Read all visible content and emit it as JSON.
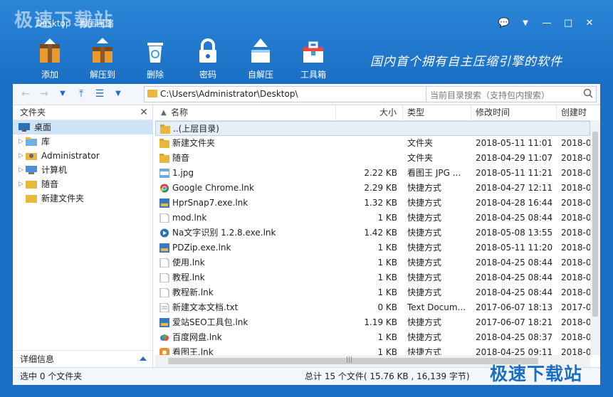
{
  "watermark": "极速下载站",
  "window": {
    "title": "Desktop - 看图压缩"
  },
  "window_controls": {
    "feedback": "💬",
    "menu": "▼",
    "minimize": "—",
    "maximize": "□",
    "close": "✕"
  },
  "toolbar": [
    {
      "label": "添加"
    },
    {
      "label": "解压到"
    },
    {
      "label": "删除"
    },
    {
      "label": "密码"
    },
    {
      "label": "自解压"
    },
    {
      "label": "工具箱"
    }
  ],
  "slogan": "国内首个拥有自主压缩引擎的软件",
  "nav": {
    "back": "←",
    "forward": "→",
    "dropdown": "▼",
    "up": "⤒",
    "view": "☰",
    "view_dd": "▼",
    "address": "C:\\Users\\Administrator\\Desktop\\",
    "search_placeholder": "当前目录搜索（支持包内搜索）"
  },
  "left_pane": {
    "title": "文件夹",
    "close": "✕",
    "items": [
      {
        "label": "桌面",
        "selected": true,
        "icon": "desktop-icon"
      },
      {
        "label": "库",
        "icon": "library-icon"
      },
      {
        "label": "Administrator",
        "icon": "user-folder-icon"
      },
      {
        "label": "计算机",
        "icon": "computer-icon"
      },
      {
        "label": "随音",
        "icon": "folder-icon"
      },
      {
        "label": "新建文件夹",
        "icon": "folder-icon"
      }
    ],
    "footer": "详细信息"
  },
  "columns": {
    "name": "名称",
    "size": "大小",
    "type": "类型",
    "modified": "修改时间",
    "created": "创建时"
  },
  "files": [
    {
      "name": "..(上层目录)",
      "size": "",
      "type": "",
      "modified": "",
      "created": "",
      "icon": "folder-icon"
    },
    {
      "name": "新建文件夹",
      "size": "",
      "type": "文件夹",
      "modified": "2018-05-11 11:01",
      "created": "2018-0",
      "icon": "folder-icon"
    },
    {
      "name": "随音",
      "size": "",
      "type": "文件夹",
      "modified": "2018-04-29 11:07",
      "created": "2018-0",
      "icon": "folder-icon"
    },
    {
      "name": "1.jpg",
      "size": "2.22 KB",
      "type": "看图王 JPG ...",
      "modified": "2018-05-11 11:21",
      "created": "2018-0",
      "icon": "jpg-icon"
    },
    {
      "name": "Google Chrome.lnk",
      "size": "2.29 KB",
      "type": "快捷方式",
      "modified": "2018-04-27 12:11",
      "created": "2018-0",
      "icon": "chrome-icon"
    },
    {
      "name": "HprSnap7.exe.lnk",
      "size": "1.32 KB",
      "type": "快捷方式",
      "modified": "2018-04-28 16:44",
      "created": "2018-0",
      "icon": "app-icon"
    },
    {
      "name": "mod.lnk",
      "size": "1 KB",
      "type": "快捷方式",
      "modified": "2018-04-25 08:44",
      "created": "2018-0",
      "icon": "file-icon"
    },
    {
      "name": "Na文字识别 1.2.8.exe.lnk",
      "size": "1.42 KB",
      "type": "快捷方式",
      "modified": "2018-05-08 13:55",
      "created": "2018-0",
      "icon": "play-icon"
    },
    {
      "name": "PDZip.exe.lnk",
      "size": "1 KB",
      "type": "快捷方式",
      "modified": "2018-05-11 11:20",
      "created": "2018-0",
      "icon": "app-icon"
    },
    {
      "name": "使用.lnk",
      "size": "1 KB",
      "type": "快捷方式",
      "modified": "2018-04-25 08:44",
      "created": "2018-0",
      "icon": "file-icon"
    },
    {
      "name": "教程.lnk",
      "size": "1 KB",
      "type": "快捷方式",
      "modified": "2018-04-25 08:44",
      "created": "2018-0",
      "icon": "file-icon"
    },
    {
      "name": "教程新.lnk",
      "size": "1 KB",
      "type": "快捷方式",
      "modified": "2018-04-25 08:44",
      "created": "2018-0",
      "icon": "file-icon"
    },
    {
      "name": "新建文本文档.txt",
      "size": "0 KB",
      "type": "Text Docum...",
      "modified": "2017-06-07 18:13",
      "created": "2017-0",
      "icon": "txt-icon"
    },
    {
      "name": "爱站SEO工具包.lnk",
      "size": "1.19 KB",
      "type": "快捷方式",
      "modified": "2017-06-07 18:21",
      "created": "2018-0",
      "icon": "app-icon"
    },
    {
      "name": "百度网盘.lnk",
      "size": "1 KB",
      "type": "快捷方式",
      "modified": "2018-04-25 08:37",
      "created": "2018-0",
      "icon": "cloud-icon"
    },
    {
      "name": "看图王.lnk",
      "size": "1 KB",
      "type": "快捷方式",
      "modified": "2018-04-25 09:11",
      "created": "2018-0",
      "icon": "image-viewer-icon"
    }
  ],
  "status": {
    "left": "选中 0 个文件夹",
    "right": "总计 15 个文件( 15.76 KB , 16,139 字节)"
  },
  "watermark_bottom": "极速下载站",
  "colors": {
    "accent": "#1a6fc4",
    "folder": "#e8b73b",
    "selection": "#cfe3f8"
  }
}
